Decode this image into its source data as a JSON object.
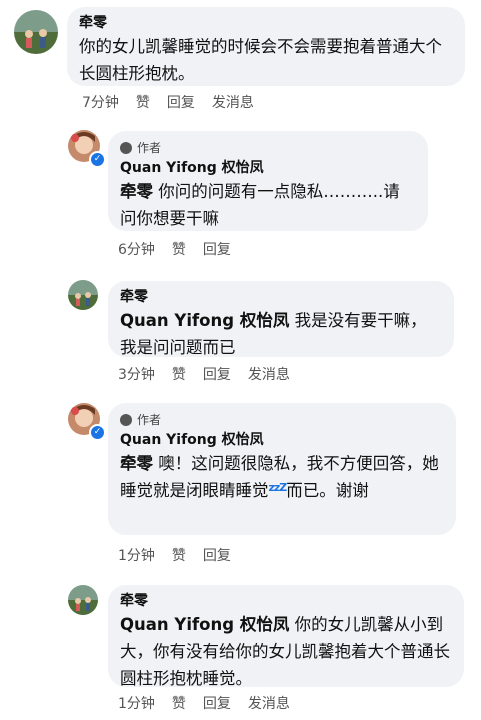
{
  "comments": [
    {
      "name": "牵零",
      "text": "你的女儿凯馨睡觉的时候会不会需要抱着普通大个长圆柱形抱枕。",
      "time": "7分钟",
      "like": "赞",
      "reply": "回复",
      "send": "发消息"
    },
    {
      "badge": "作者",
      "name": "Quan Yifong 权怡凤",
      "mention": "牵零",
      "text": " 你问的问题有一点隐私………..请问你想要干嘛",
      "time": "6分钟",
      "like": "赞",
      "reply": "回复"
    },
    {
      "name": "牵零",
      "mention": "Quan Yifong 权怡凤",
      "text": " 我是没有要干嘛，我是问问题而已",
      "time": "3分钟",
      "like": "赞",
      "reply": "回复",
      "send": "发消息"
    },
    {
      "badge": "作者",
      "name": "Quan Yifong 权怡凤",
      "mention": "牵零",
      "text_a": " 噢！这问题很隐私，我不方便回答，她睡觉就是闭眼睛睡觉",
      "zz": "zzZ",
      "text_b": "而已。谢谢",
      "time": "1分钟",
      "like": "赞",
      "reply": "回复"
    },
    {
      "name": "牵零",
      "mention": "Quan Yifong 权怡凤",
      "text": " 你的女儿凯馨从小到大，你有没有给你的女儿凯馨抱着大个普通长圆柱形抱枕睡觉。",
      "time": "1分钟",
      "like": "赞",
      "reply": "回复",
      "send": "发消息"
    }
  ],
  "colors": {
    "bubble": "#f0f2f5",
    "verified": "#1b74e4",
    "meta": "#555555"
  }
}
